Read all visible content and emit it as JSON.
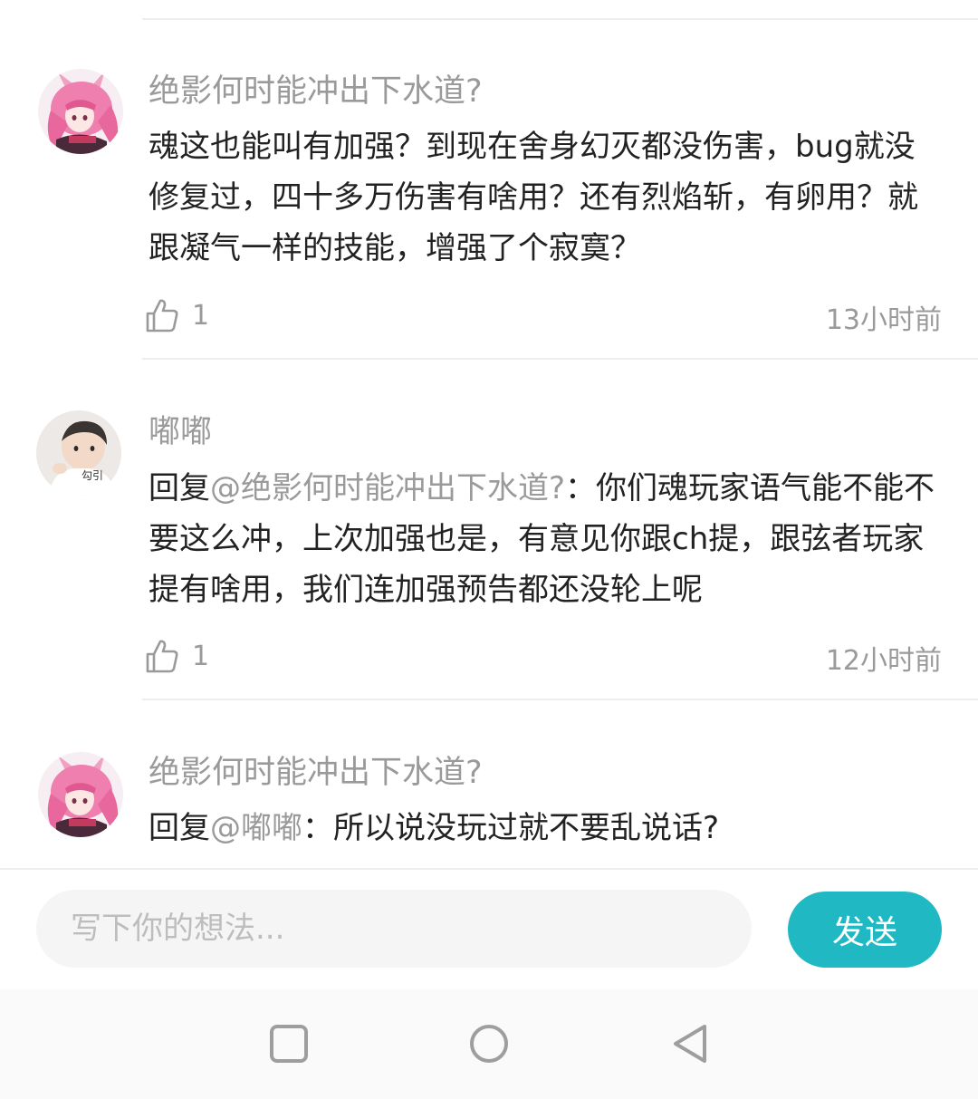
{
  "comments": [
    {
      "username": "绝影何时能冲出下水道?",
      "reply_prefix": "",
      "text": "魂这也能叫有加强？到现在舍身幻灭都没伤害，bug就没修复过，四十多万伤害有啥用？还有烈焰斩，有卵用？就跟凝气一样的技能，增强了个寂寞？",
      "likes": "1",
      "time": "13小时前",
      "avatar": "pink-hair-anime-avatar"
    },
    {
      "username": "嘟嘟",
      "reply_prefix": "回复",
      "reply_mention": "@绝影何时能冲出下水道?",
      "reply_sep": "：",
      "text": "你们魂玩家语气能不能不要这么冲，上次加强也是，有意见你跟ch提，跟弦者玩家提有啥用，我们连加强预告都还没轮上呢",
      "likes": "1",
      "time": "12小时前",
      "avatar": "baby-photo-avatar",
      "avatar_caption": "勾引"
    },
    {
      "username": "绝影何时能冲出下水道?",
      "reply_prefix": "回复",
      "reply_mention": "@嘟嘟",
      "reply_sep": "：",
      "text": "所以说没玩过就不要乱说话?",
      "avatar": "pink-hair-anime-avatar"
    }
  ],
  "composer": {
    "placeholder": "写下你的想法...",
    "send_label": "发送",
    "accent_color": "#1fb8c3"
  },
  "navbar": {
    "buttons": [
      "recent-apps-icon",
      "home-icon",
      "back-icon"
    ]
  }
}
